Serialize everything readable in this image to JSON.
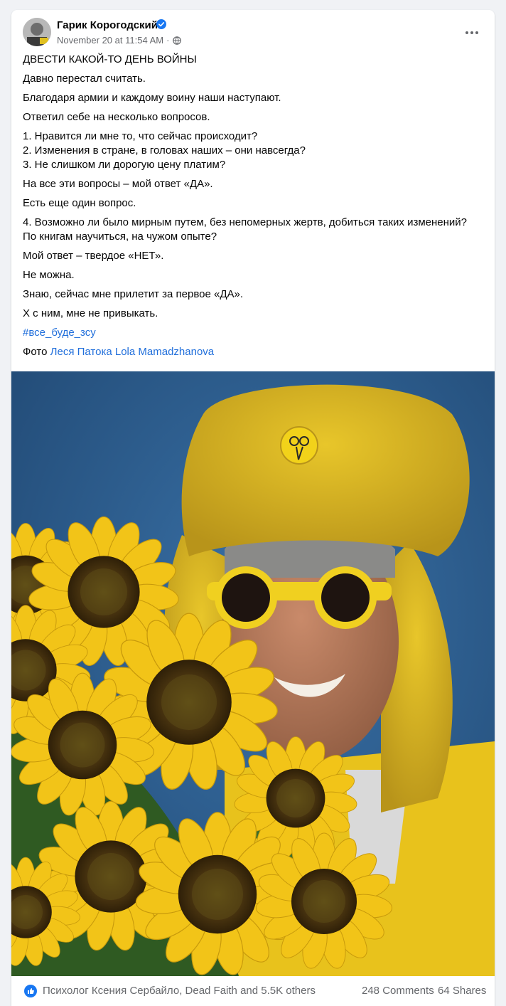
{
  "post": {
    "author": "Гарик Корогодский",
    "timestamp": "November 20 at 11:54 AM",
    "meta_sep": "·",
    "title": "ДВЕСТИ КАКОЙ-ТО ДЕНЬ ВОЙНЫ",
    "paragraphs": [
      "Давно перестал считать.",
      "Благодаря армии и каждому воину наши наступают.",
      "Ответил себе на несколько вопросов."
    ],
    "questions": [
      "1.  Нравится ли мне то, что сейчас происходит?",
      "2.  Изменения в стране, в головах наших – они навсегда?",
      "3.  Не слишком ли дорогую цену платим?"
    ],
    "answer1": "На все эти вопросы – мой ответ «ДА».",
    "one_more": "Есть еще один вопрос.",
    "question4_line1": "4.  Возможно ли было мирным путем, без непомерных жертв, добиться таких изменений?",
    "question4_line2": "По книгам научиться, на чужом опыте?",
    "answer2": "Мой ответ – твердое «НЕТ».",
    "ne_mozhna": "Не можна.",
    "znayu": "Знаю, сейчас мне прилетит за первое «ДА».",
    "x_s_nim": "Х с ним, мне не привыкать.",
    "hashtag": "#все_буде_зсу",
    "photo_label": "Фото",
    "photo_credit1": "Леся Патока",
    "photo_credit2": "Lola Mamadzhanova"
  },
  "footer": {
    "reactions": "Психолог Ксения Сербайло, Dead Faith and 5.5K others",
    "comments": "248 Comments",
    "shares": "64 Shares"
  },
  "icons": {
    "verified": "verified-badge-icon",
    "globe": "globe-icon",
    "like": "like-reaction-icon",
    "more": "more-options-icon"
  },
  "colors": {
    "link": "#216fdb",
    "verified": "#1877f2",
    "background": "#f0f2f5",
    "photo_background": "#2b5a8e",
    "hat_yellow": "#d9b51a"
  }
}
